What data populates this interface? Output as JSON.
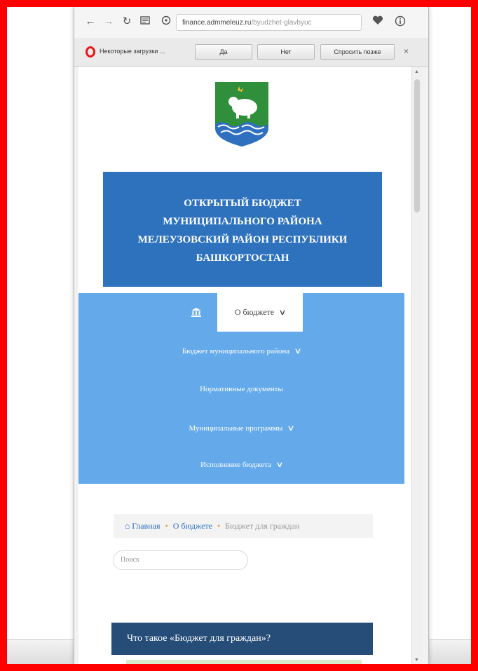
{
  "browser": {
    "url_host": "finance.admmeleuz.ru",
    "url_path": "/byudzhet-glavbyuc"
  },
  "download_bar": {
    "message": "Некоторые загрузки ...",
    "yes_label": "Да",
    "no_label": "Нет",
    "ask_later_label": "Спросить позже",
    "close_label": "×"
  },
  "site": {
    "banner_lines": [
      "ОТКРЫТЫЙ БЮДЖЕТ",
      "МУНИЦИПАЛЬНОГО РАЙОНА",
      "МЕЛЕУЗОВСКИЙ РАЙОН РЕСПУБЛИКИ",
      "БАШКОРТОСТАН"
    ]
  },
  "nav": {
    "active_label": "О бюджете",
    "items": [
      {
        "label": "Бюджет муниципального района",
        "has_submenu": true
      },
      {
        "label": "Нормативные документы",
        "has_submenu": false
      },
      {
        "label": "Муниципальные программы",
        "has_submenu": true
      },
      {
        "label": "Исполнение бюджета",
        "has_submenu": true
      }
    ]
  },
  "breadcrumb": {
    "home": "Главная",
    "section": "О бюджете",
    "current": "Бюджет для граждан",
    "separator": "•"
  },
  "search": {
    "placeholder": "Поиск"
  },
  "content": {
    "card_title": "Что такое «Бюджет для граждан»?"
  },
  "colors": {
    "frame": "#ff0000",
    "banner": "#2e72be",
    "nav": "#64aaea",
    "card_header": "#254d78"
  }
}
